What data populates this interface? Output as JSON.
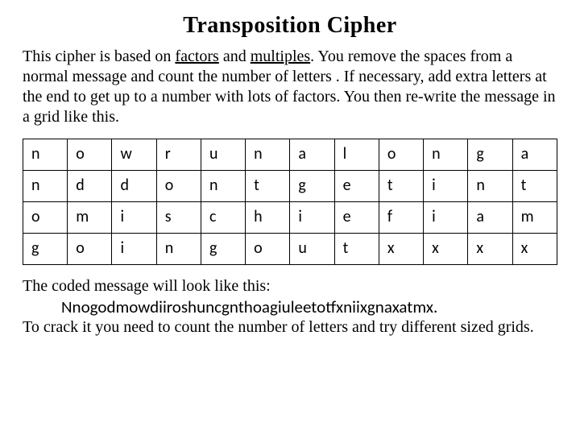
{
  "title": "Transposition Cipher",
  "intro": {
    "pre": " This cipher is based on ",
    "factors": "factors",
    "and": " and ",
    "multiples": "multiples",
    "post": ". You remove the spaces from a normal message and count the number of letters . If necessary, add extra letters at the end to get up to a number with lots of factors. You then re-write the message in a grid like this."
  },
  "grid": [
    [
      "n",
      "o",
      "w",
      "r",
      "u",
      "n",
      "a",
      "l",
      "o",
      "n",
      "g",
      "a"
    ],
    [
      "n",
      "d",
      "d",
      "o",
      "n",
      "t",
      "g",
      "e",
      "t",
      "i",
      "n",
      "t"
    ],
    [
      "o",
      "m",
      "i",
      "s",
      "c",
      "h",
      "i",
      "e",
      "f",
      "i",
      "a",
      "m"
    ],
    [
      "g",
      "o",
      "i",
      "n",
      "g",
      "o",
      "u",
      "t",
      "x",
      "x",
      "x",
      "x"
    ]
  ],
  "footer": {
    "line1": "The coded message will look like this:",
    "coded": "Nnogodmowdiiroshuncgnthoagiuleetotfxniixgnaxatmx.",
    "line2": "To crack it you need to count the number of letters and try different sized grids."
  }
}
